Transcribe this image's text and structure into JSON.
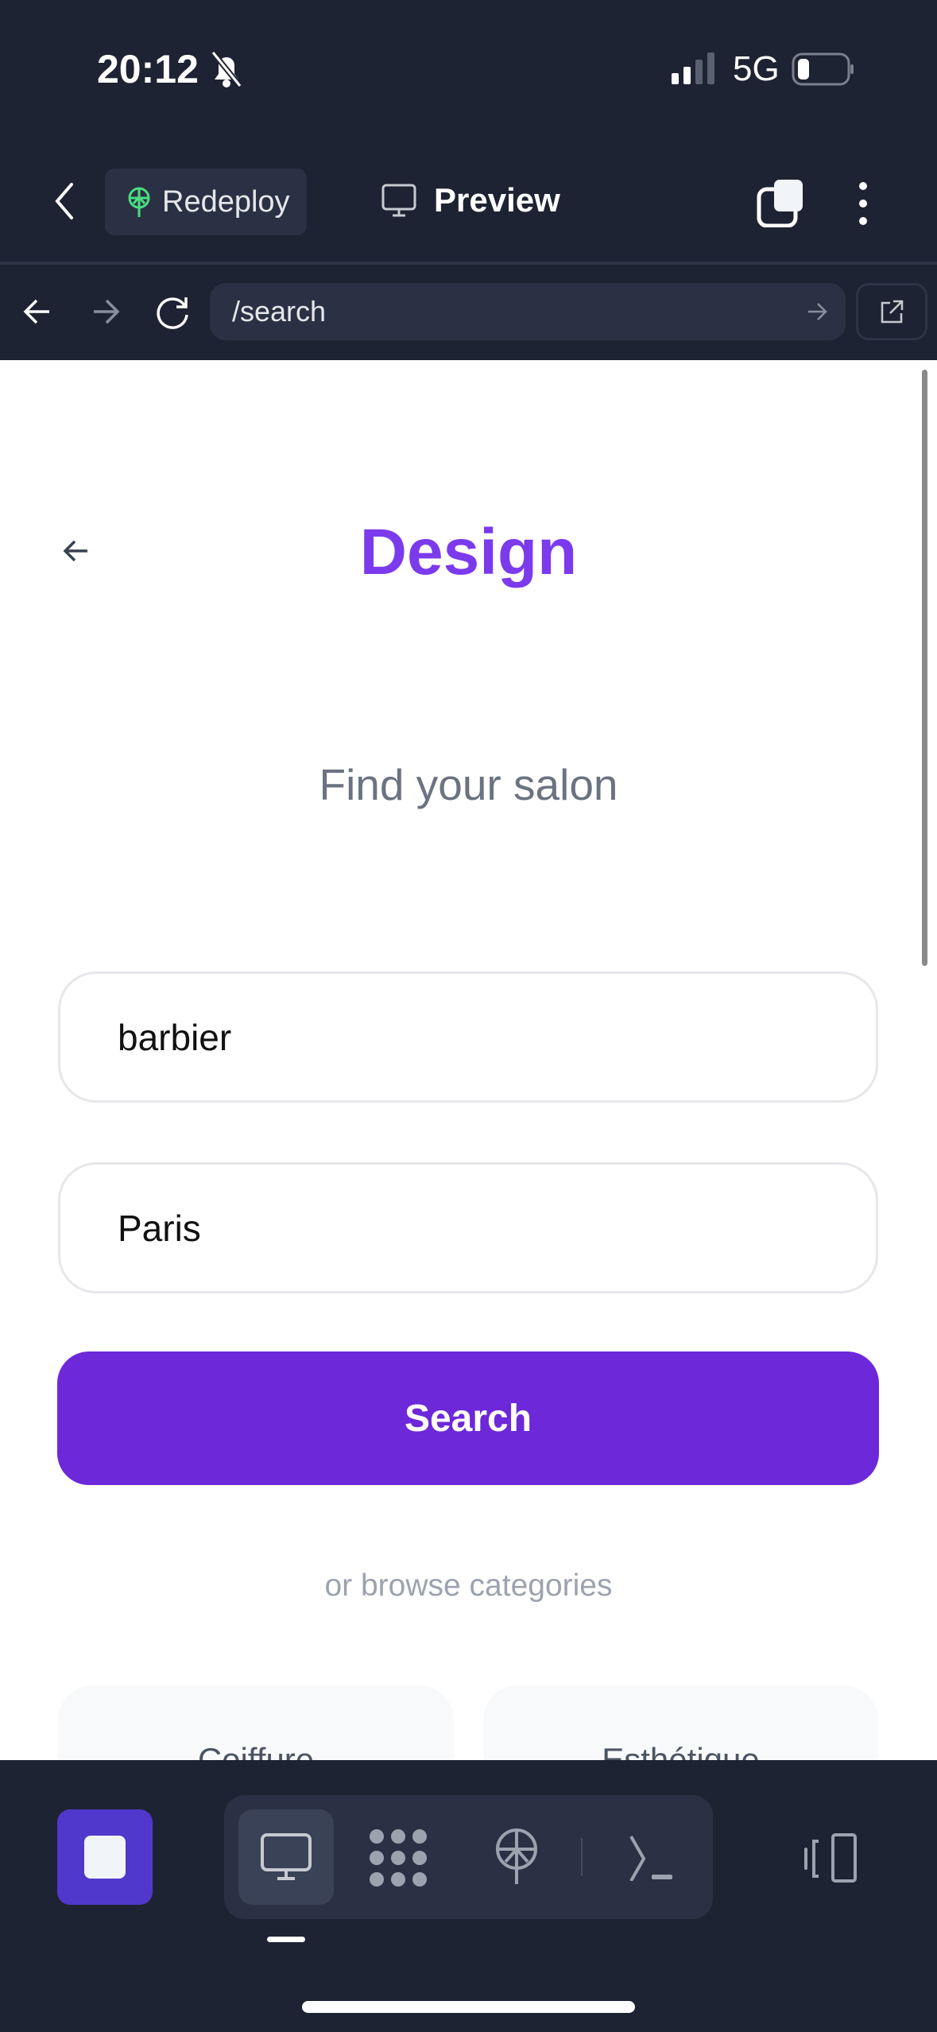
{
  "status_bar": {
    "time": "20:12",
    "network": "5G",
    "battery_level": 0.2
  },
  "app_header": {
    "redeploy_label": "Redeploy",
    "preview_label": "Preview"
  },
  "browser": {
    "url": "/search"
  },
  "page": {
    "brand": "Design",
    "subtitle": "Find your salon",
    "query_value": "barbier",
    "location_value": "Paris",
    "search_label": "Search",
    "browse_text": "or browse categories",
    "categories": [
      {
        "label": "Coiffure"
      },
      {
        "label": "Esthétique"
      }
    ]
  },
  "colors": {
    "accent": "#7c3aed",
    "button": "#6d28d9",
    "bar_bg": "#1e2333",
    "stop_button": "#5138cc",
    "redeploy_icon": "#4ade80"
  }
}
